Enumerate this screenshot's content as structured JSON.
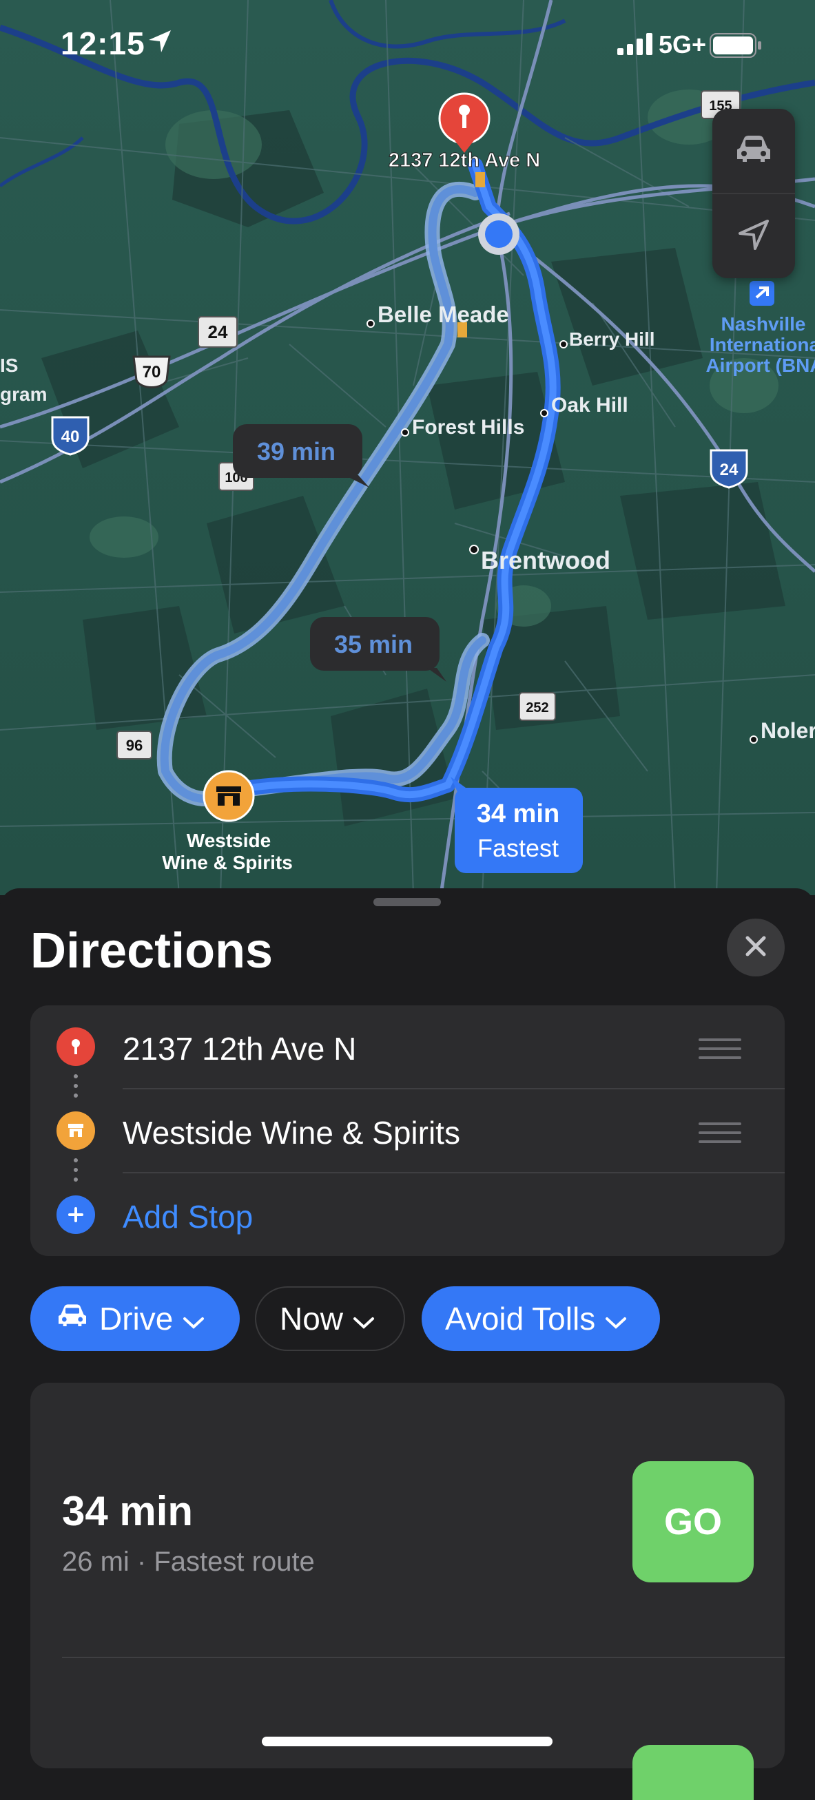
{
  "status_bar": {
    "time": "12:15",
    "network": "5G+"
  },
  "map": {
    "labels": {
      "destination_pin": "2137 12th Ave N",
      "belle_meade": "Belle Meade",
      "berry_hill": "Berry Hill",
      "oak_hill": "Oak Hill",
      "forest_hills": "Forest Hills",
      "brentwood": "Brentwood",
      "nolensville": "Noler",
      "airport_line1": "Nashville",
      "airport_line2": "Internationa",
      "airport_line3": "Airport (BNA",
      "edge_1": "IS",
      "edge_2": "gram",
      "store_line1": "Westside",
      "store_line2": "Wine & Spirits"
    },
    "shields": {
      "i40": "40",
      "i24": "24",
      "us70": "70",
      "r24": "24",
      "r100": "100",
      "r96": "96",
      "r252": "252",
      "r155": "155"
    },
    "route_callouts": {
      "route_1_time": "39 min",
      "route_2_time": "35 min",
      "route_3_time": "34 min",
      "route_3_tag": "Fastest"
    }
  },
  "sheet": {
    "title": "Directions",
    "stops": [
      {
        "label": "2137 12th Ave N",
        "icon": "pin-icon",
        "color": "#e5453a"
      },
      {
        "label": "Westside Wine & Spirits",
        "icon": "store-icon",
        "color": "#f2a33a"
      },
      {
        "label": "Add Stop",
        "icon": "plus-icon",
        "color": "#3478f6"
      }
    ],
    "chips": {
      "drive": "Drive",
      "when": "Now",
      "avoid": "Avoid Tolls"
    },
    "route": {
      "eta": "34 min",
      "details": "26 mi · Fastest route",
      "go_label": "GO"
    }
  },
  "colors": {
    "accent": "#3478f6",
    "go": "#6fd16a",
    "sheet": "#1c1c1e",
    "card": "#2c2c2e"
  }
}
